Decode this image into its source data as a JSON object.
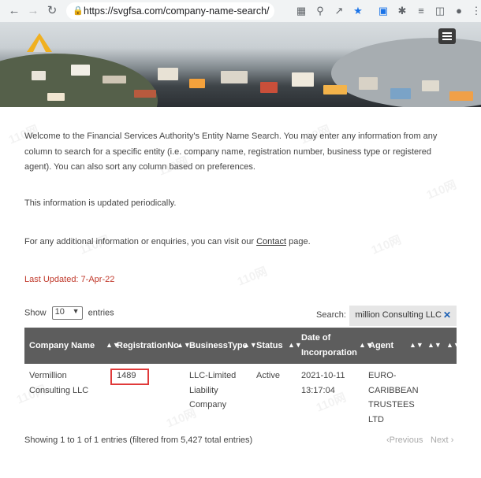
{
  "browser": {
    "url": "https://svgfsa.com/company-name-search/"
  },
  "intro": {
    "line1": "Welcome to the Financial Services Authority's Entity Name Search. You may enter any information from any",
    "line2": "column to search for a specific entity (i.e. company name, registration number, business type or registered",
    "line3": "agent). You can also sort any column based on preferences.",
    "periodic": "This information is updated periodically.",
    "contact_prefix": "For any additional information or enquiries, you can visit our",
    "contact_link": "Contact",
    "contact_suffix": "page."
  },
  "updated": "Last Updated:  7-Apr-22",
  "controls": {
    "show_label": "Show",
    "entries_value": "10",
    "entries_label": "entries",
    "search_label": "Search:",
    "search_value": "Vermillion Consulting LLC"
  },
  "table": {
    "headers": [
      "Company Name",
      "RegistrationNo",
      "BusinessType",
      "Status",
      "Date of",
      "Incorporation",
      "Agent"
    ],
    "row": {
      "name1": "Vermillion",
      "name2": "Consulting LLC",
      "reg": "1489",
      "type1": "LLC-Limited",
      "type2": "Liability",
      "type3": "Company",
      "status": "Active",
      "date1": "2021-10-11",
      "date2": "13:17:04",
      "agent1": "EURO-",
      "agent2": "CARIBBEAN",
      "agent3": "TRUSTEES",
      "agent4": "LTD"
    }
  },
  "footer": {
    "info": "Showing 1 to 1 of 1 entries (filtered from 5,427 total entries)",
    "previous": "Previous",
    "next": "Next"
  },
  "watermark": "110网"
}
